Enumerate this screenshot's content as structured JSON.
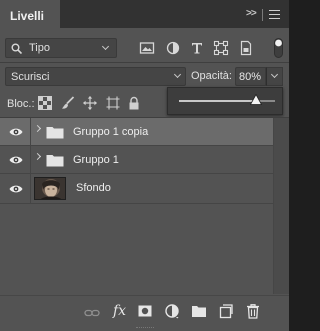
{
  "panel": {
    "tab_title": "Livelli",
    "collapse_glyph": ">>"
  },
  "filter": {
    "kind_label": "Tipo",
    "icons": [
      "image-filter-icon",
      "adjustment-filter-icon",
      "type-filter-icon",
      "shape-filter-icon",
      "smart-object-filter-icon"
    ]
  },
  "blend": {
    "mode_label": "Scurisci",
    "opacity_label": "Opacità:",
    "opacity_value": "80%"
  },
  "opacity_slider": {
    "fraction": 0.8
  },
  "lock": {
    "label": "Bloc.:",
    "icons": [
      "lock-transparent-pixels-icon",
      "lock-image-pixels-icon",
      "lock-position-icon",
      "lock-artboard-icon",
      "lock-all-icon"
    ]
  },
  "layers": [
    {
      "name": "Gruppo 1 copia",
      "type": "group",
      "visible": true,
      "selected": true
    },
    {
      "name": "Gruppo 1",
      "type": "group",
      "visible": true,
      "selected": false
    },
    {
      "name": "Sfondo",
      "type": "pixel",
      "visible": true,
      "selected": false
    }
  ],
  "footer": {
    "fx_label": "fx",
    "icons": [
      "link-layers-icon",
      "fx-icon",
      "add-mask-icon",
      "adjustment-layer-icon",
      "new-group-icon",
      "new-layer-icon",
      "delete-layer-icon"
    ]
  },
  "colors": {
    "panel_bg": "#535353",
    "selected_row": "#6b6b6b",
    "header_bg": "#323232"
  }
}
